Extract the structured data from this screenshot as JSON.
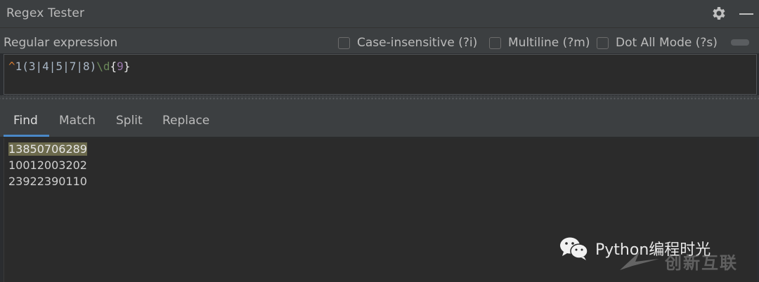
{
  "window": {
    "title": "Regex Tester",
    "gear_icon": "gear-icon",
    "minimize_icon": "minimize-icon"
  },
  "regex": {
    "label": "Regular expression",
    "options": [
      {
        "label": "Case-insensitive (?i)",
        "checked": false
      },
      {
        "label": "Multiline (?m)",
        "checked": false
      },
      {
        "label": "Dot All Mode (?s)",
        "checked": false
      }
    ],
    "pattern_parts": [
      "^",
      "1(3|4|5|7|8)",
      "\\d",
      "{",
      "9",
      "}"
    ]
  },
  "tabs": [
    {
      "label": "Find",
      "active": true
    },
    {
      "label": "Match",
      "active": false
    },
    {
      "label": "Split",
      "active": false
    },
    {
      "label": "Replace",
      "active": false
    }
  ],
  "results": {
    "lines": [
      "13850706289",
      "10012003202",
      "23922390110"
    ],
    "matched_line_index": 0
  },
  "watermark": {
    "text": "Python编程时光",
    "logo_text": "创新互联"
  },
  "colors": {
    "accent": "#4a88c7",
    "match_highlight": "#6c6a4c"
  }
}
